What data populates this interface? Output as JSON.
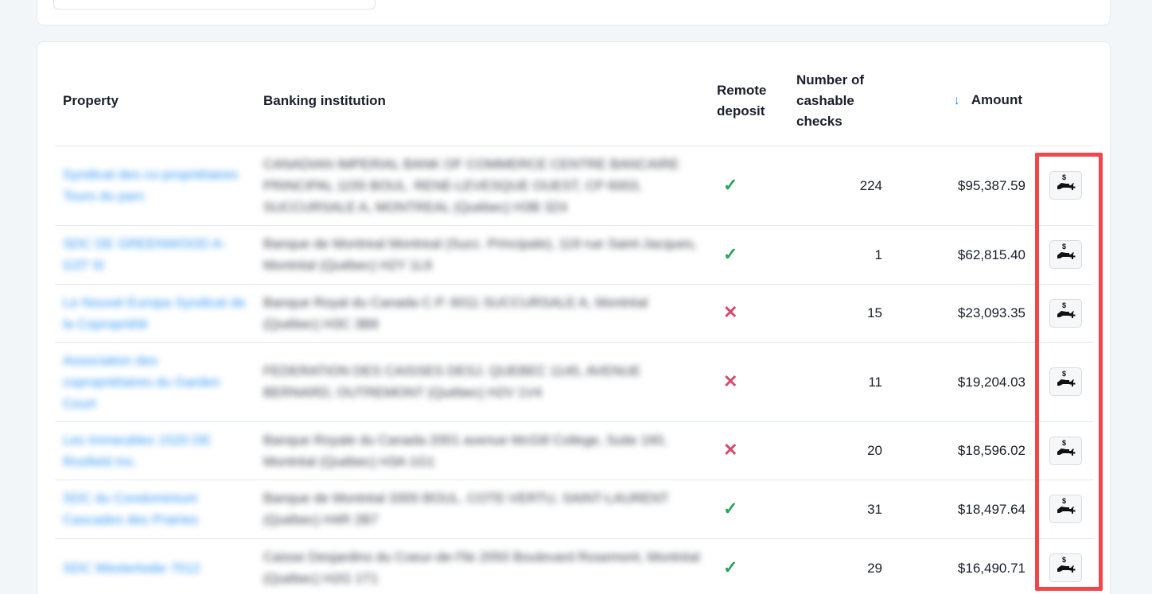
{
  "table": {
    "headers": {
      "property": "Property",
      "bank": "Banking institution",
      "remote": "Remote deposit",
      "checks": "Number of cashable checks",
      "amount": "Amount"
    },
    "rows": [
      {
        "property": "Syndicat des co-propriétaires Tours du parc",
        "bank": "CANADIAN IMPERIAL BANK OF COMMERCE CENTRE BANCAIRE PRINCIPAL 1155 BOUL. RENE-LEVESQUE OUEST, CP 6003, SUCCURSALE A, MONTREAL (Québec) H3B 3Z4",
        "remote": "✓",
        "checks": "224",
        "amount": "$95,387.59"
      },
      {
        "property": "SDC DE GREENWOOD A-G3T I0",
        "bank": "Banque de Montreal Montreal (Succ. Principale), 119 rue Saint-Jacques, Montréal (Québec) H2Y 1L6",
        "remote": "✓",
        "checks": "1",
        "amount": "$62,815.40"
      },
      {
        "property": "Le Nouvel Europa Syndicat de la Copropriété",
        "bank": "Banque Royal du Canada C.P. 6011 SUCCURSALE A, Montréal (Québec) H3C 3B8",
        "remote": "✕",
        "checks": "15",
        "amount": "$23,093.35"
      },
      {
        "property": "Association des copropriétaires du Garden Court",
        "bank": "FEDERATION DES CAISSES DESJ. QUEBEC 1145, AVENUE BERNARD, OUTREMONT (Québec) H2V 1V4",
        "remote": "✕",
        "checks": "11",
        "amount": "$19,204.03"
      },
      {
        "property": "Les Immeubles 1520 DE Rosfield Inc.",
        "bank": "Banque Royale du Canada 2001 avenue McGill College, Suite 160, Montréal (Québec) H3A 1G1",
        "remote": "✕",
        "checks": "20",
        "amount": "$18,596.02"
      },
      {
        "property": "SDC du Condominium Cascades des Prairies",
        "bank": "Banque de Montréal 3300 BOUL. COTE-VERTU, SAINT-LAURENT (Québec) H4R 2B7",
        "remote": "✓",
        "checks": "31",
        "amount": "$18,497.64"
      },
      {
        "property": "SDC Westerlodie 7012",
        "bank": "Caisse Desjardins du Coeur-de-l'île 2050 Boulevard Rosemont, Montréal (Québec) H2G 1T1",
        "remote": "✓",
        "checks": "29",
        "amount": "$16,490.71"
      }
    ],
    "action_icon": "cash-deposit-icon"
  },
  "colors": {
    "link": "#2f95f5",
    "check": "#28a35a",
    "cross": "#d9486b",
    "highlight": "#f0474c",
    "sort_arrow": "#1f8ef1"
  }
}
